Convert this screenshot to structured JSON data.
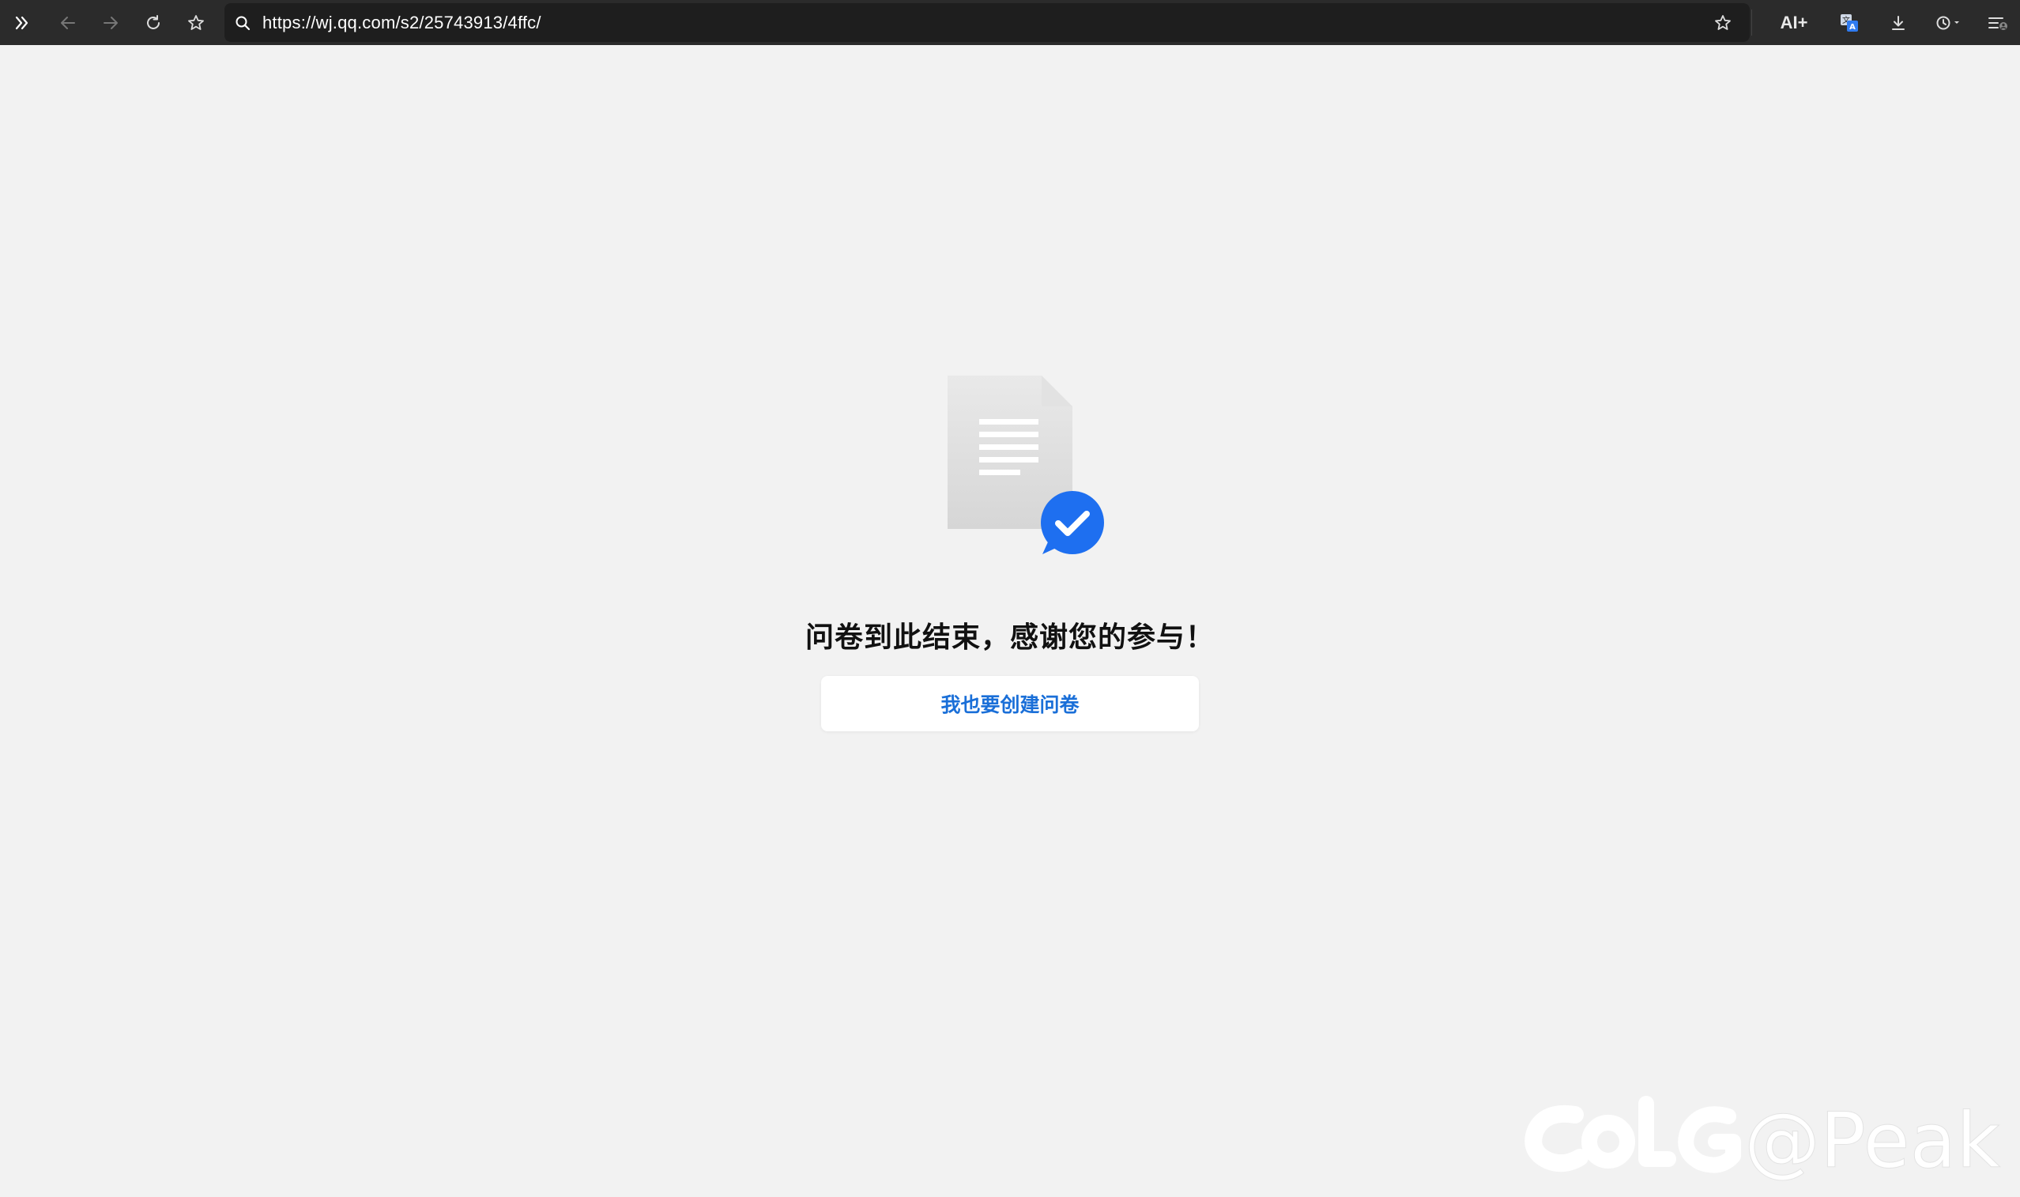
{
  "browser": {
    "url": "https://wj.qq.com/s2/25743913/4ffc/",
    "ai_label": "AI+",
    "icons": {
      "sidebar_toggle": "double-chevron-right-icon",
      "back": "arrow-left-icon",
      "forward": "arrow-right-icon",
      "reload": "reload-icon",
      "favorite": "star-icon",
      "search": "search-icon",
      "bookmark": "star-icon",
      "translate": "translate-icon",
      "download": "download-icon",
      "history": "history-icon",
      "menu": "menu-icon"
    }
  },
  "page": {
    "end_message": "问卷到此结束，感谢您的参与！",
    "create_button_label": "我也要创建问卷",
    "watermark": "COLG@Peak"
  },
  "colors": {
    "toolbar_bg": "#2b2b2b",
    "page_bg": "#f2f2f2",
    "accent_blue": "#1a6fd8",
    "check_badge": "#1e6ff0"
  }
}
